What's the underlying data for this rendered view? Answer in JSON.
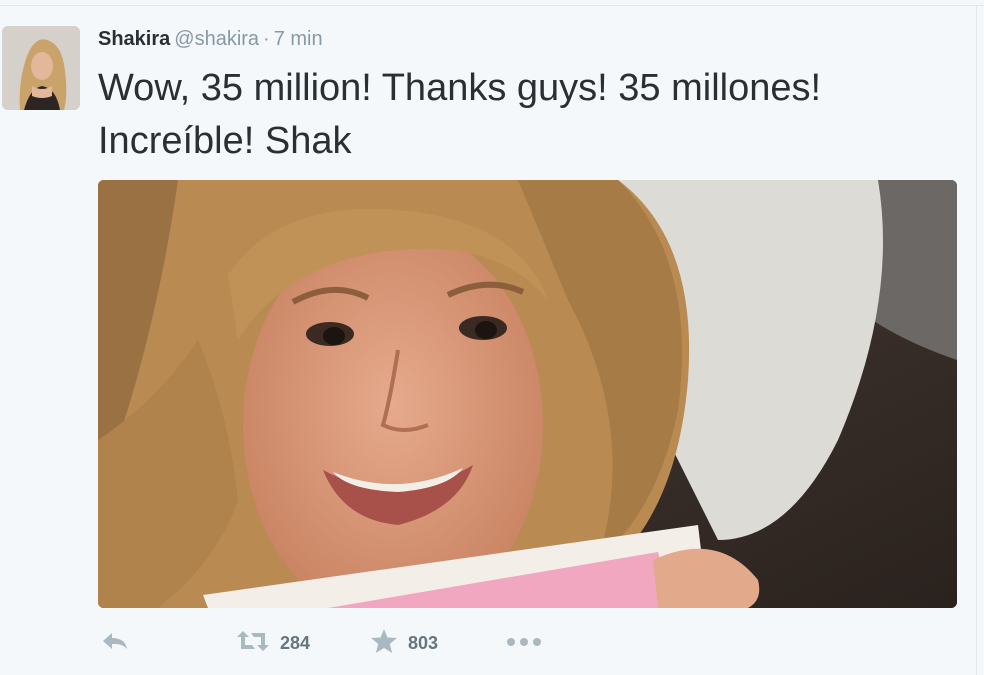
{
  "tweet": {
    "display_name": "Shakira",
    "handle": "@shakira",
    "separator": "·",
    "time": "7 min",
    "text": "Wow, 35 million! Thanks guys! 35 millones! Increíble! Shak",
    "avatar_icon": "profile-photo",
    "media_icon": "selfie-photo"
  },
  "actions": {
    "reply": {
      "icon": "reply-icon"
    },
    "retweet": {
      "icon": "retweet-icon",
      "count": "284"
    },
    "favorite": {
      "icon": "star-icon",
      "count": "803"
    },
    "more": {
      "icon": "more-icon"
    }
  },
  "colors": {
    "background": "#f5f8fa",
    "name": "#292f33",
    "meta": "#8899a6",
    "action_icon": "#aab8c2",
    "action_count": "#66757f"
  }
}
